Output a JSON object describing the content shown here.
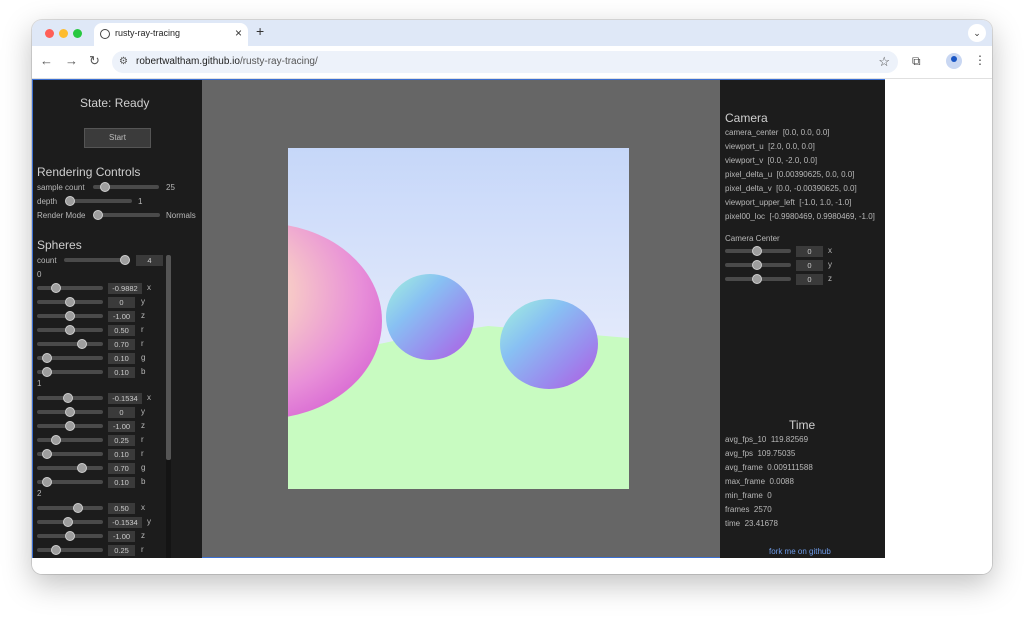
{
  "browser": {
    "tab_title": "rusty-ray-tracing",
    "close_glyph": "×",
    "new_tab_glyph": "+",
    "tab_menu_glyph": "⌄",
    "url_host": "robertwaltham.github.io",
    "url_path": "/rusty-ray-tracing/",
    "back_glyph": "←",
    "forward_glyph": "→",
    "reload_glyph": "↻",
    "site_info_glyph": "⚙",
    "star_glyph": "☆",
    "extensions_glyph": "⧉",
    "menu_glyph": "⋮",
    "traffic_colors": [
      "#ff5f57",
      "#febc2e",
      "#28c840"
    ]
  },
  "left": {
    "state": "State: Ready",
    "start_label": "Start",
    "rendering_title": "Rendering Controls",
    "sample_label": "sample count",
    "sample_value": "25",
    "depth_label": "depth",
    "depth_value": "1",
    "mode_label": "Render Mode",
    "mode_value": "Normals",
    "spheres_title": "Spheres",
    "count_label": "count",
    "count_value": "4",
    "sphere0_label": "0",
    "sphere1_label": "1",
    "sphere2_label": "2",
    "rows0": [
      {
        "value": "-0.9882",
        "axis": "x"
      },
      {
        "value": "0",
        "axis": "y"
      },
      {
        "value": "-1.00",
        "axis": "z"
      },
      {
        "value": "0.50",
        "axis": "r"
      },
      {
        "value": "0.70",
        "axis": "r"
      },
      {
        "value": "0.10",
        "axis": "g"
      },
      {
        "value": "0.10",
        "axis": "b"
      }
    ],
    "rows1": [
      {
        "value": "-0.1534",
        "axis": "x"
      },
      {
        "value": "0",
        "axis": "y"
      },
      {
        "value": "-1.00",
        "axis": "z"
      },
      {
        "value": "0.25",
        "axis": "r"
      },
      {
        "value": "0.10",
        "axis": "r"
      },
      {
        "value": "0.70",
        "axis": "g"
      },
      {
        "value": "0.10",
        "axis": "b"
      }
    ],
    "rows2": [
      {
        "value": "0.50",
        "axis": "x"
      },
      {
        "value": "-0.1534",
        "axis": "y"
      },
      {
        "value": "-1.00",
        "axis": "z"
      },
      {
        "value": "0.25",
        "axis": "r"
      }
    ]
  },
  "right": {
    "camera_title": "Camera",
    "cam_rows": [
      {
        "label": "camera_center",
        "value": "[0.0, 0.0, 0.0]"
      },
      {
        "label": "viewport_u",
        "value": "[2.0, 0.0, 0.0]"
      },
      {
        "label": "viewport_v",
        "value": "[0.0, -2.0, 0.0]"
      },
      {
        "label": "pixel_delta_u",
        "value": "[0.00390625, 0.0, 0.0]"
      },
      {
        "label": "pixel_delta_v",
        "value": "[0.0, -0.00390625, 0.0]"
      },
      {
        "label": "viewport_upper_left",
        "value": "[-1.0, 1.0, -1.0]"
      },
      {
        "label": "pixel00_loc",
        "value": "[-0.9980469, 0.9980469, -1.0]"
      }
    ],
    "camera_center_title": "Camera Center",
    "cc_rows": [
      {
        "value": "0",
        "axis": "x"
      },
      {
        "value": "0",
        "axis": "y"
      },
      {
        "value": "0",
        "axis": "z"
      }
    ],
    "time_title": "Time",
    "time_rows": [
      {
        "label": "avg_fps_10",
        "value": "119.82569"
      },
      {
        "label": "avg_fps",
        "value": "109.75035"
      },
      {
        "label": "avg_frame",
        "value": "0.009111588"
      },
      {
        "label": "max_frame",
        "value": "0.0088"
      },
      {
        "label": "min_frame",
        "value": "0"
      },
      {
        "label": "frames",
        "value": "2570"
      },
      {
        "label": "time",
        "value": "23.41678"
      }
    ],
    "fork_link": "fork me on github"
  }
}
